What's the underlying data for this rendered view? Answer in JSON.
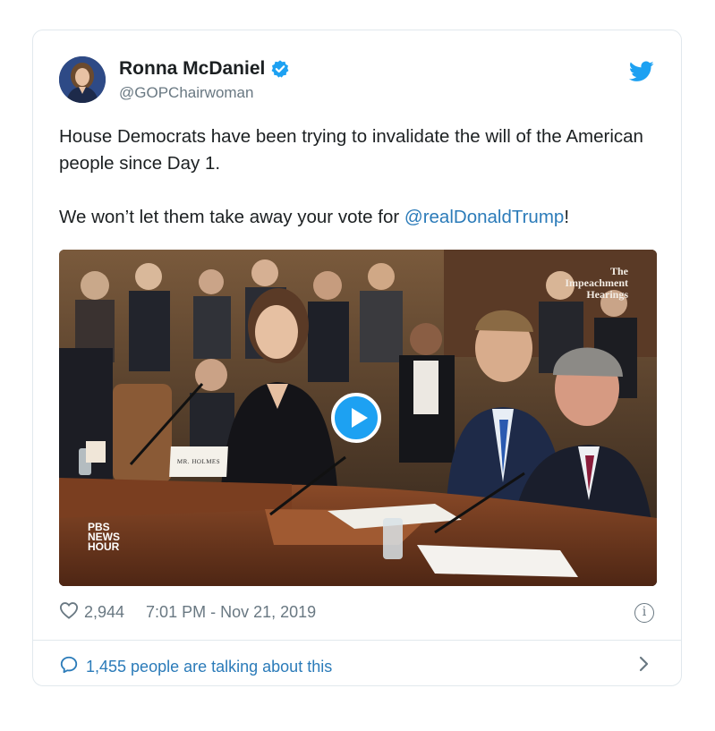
{
  "tweet": {
    "author_name": "Ronna McDaniel",
    "handle": "@GOPChairwoman",
    "text_line1": "House Democrats have been trying to invalidate the will of the American people since Day 1.",
    "text_line2_prefix": "We won’t let them take away your vote for ",
    "text_line2_mention": "@realDonaldTrump",
    "text_line2_suffix": "!",
    "media": {
      "watermark_line1": "The",
      "watermark_line2": "Impeachment",
      "watermark_line3": "Hearings",
      "broadcaster_line1": "PBS",
      "broadcaster_line2": "NEWS",
      "broadcaster_line3": "HOUR",
      "nameplate": "MR. HOLMES"
    },
    "likes": "2,944",
    "time": "7:01 PM",
    "date": "Nov 21, 2019",
    "talking": "1,455 people are talking about this"
  },
  "icons": {
    "verified": "verified-badge-icon",
    "brand": "twitter-bird-icon",
    "like": "heart-icon",
    "info": "info-icon",
    "reply": "speech-bubble-icon",
    "chevron": "chevron-right-icon"
  },
  "colors": {
    "twitter_blue": "#1da1f2",
    "link_blue": "#2b7bb9",
    "meta_gray": "#697882",
    "border": "#e1e8ed"
  }
}
